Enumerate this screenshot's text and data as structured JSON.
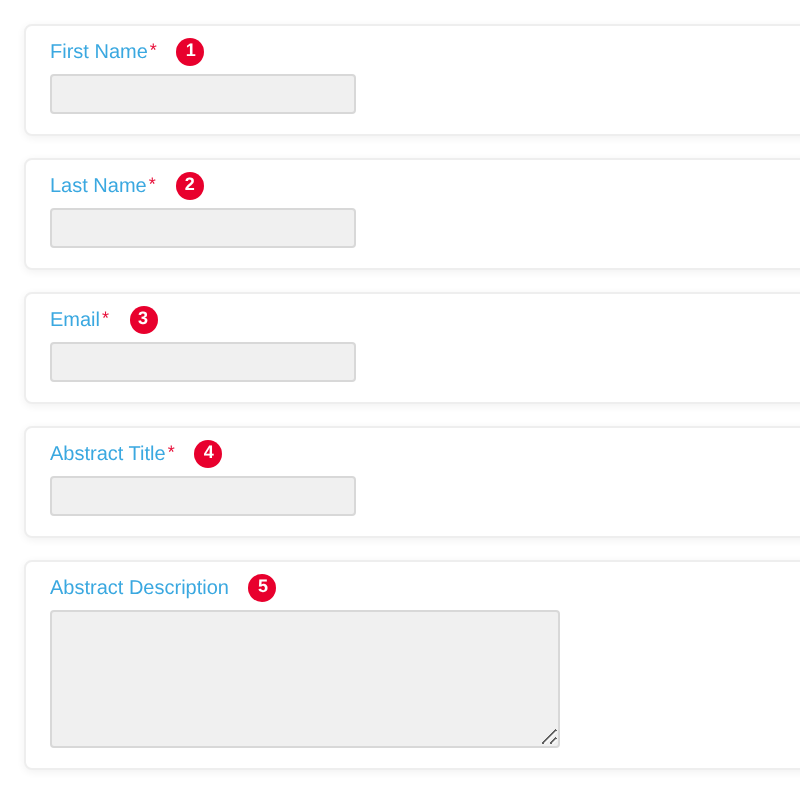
{
  "fields": [
    {
      "label": "First Name",
      "required_mark": "*",
      "badge": "1",
      "kind": "input"
    },
    {
      "label": "Last Name",
      "required_mark": "*",
      "badge": "2",
      "kind": "input"
    },
    {
      "label": "Email",
      "required_mark": "*",
      "badge": "3",
      "kind": "input"
    },
    {
      "label": "Abstract Title",
      "required_mark": "*",
      "badge": "4",
      "kind": "input"
    },
    {
      "label": "Abstract Description",
      "badge": "5",
      "kind": "textarea"
    }
  ]
}
